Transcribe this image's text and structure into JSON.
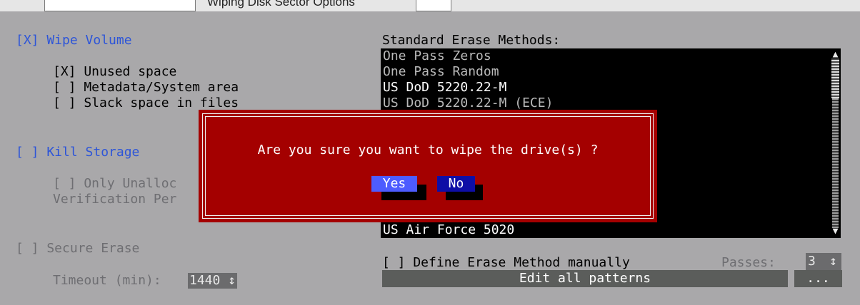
{
  "top_bar": {
    "text": "Wiping Disk Sector Options"
  },
  "wipe_volume": {
    "label": "[X] Wipe Volume",
    "options": [
      "[X] Unused space",
      "[ ] Metadata/System area",
      "[ ] Slack space in files"
    ]
  },
  "kill_storage": {
    "label": "[ ] Kill Storage",
    "options": [
      "[ ] Only Unalloc",
      "Verification Per"
    ]
  },
  "secure_erase": {
    "label": "[ ] Secure Erase",
    "timeout_label": "Timeout (min):",
    "timeout_value": "1440",
    "stepper_glyph": "↕"
  },
  "methods": {
    "heading": "Standard Erase Methods:",
    "items": [
      "One Pass Zeros",
      "One Pass Random",
      "US DoD 5220.22-M",
      "US DoD 5220.22-M (ECE)"
    ],
    "last_item": "US Air Force 5020",
    "scroll_up": "▲",
    "scroll_down": "▼"
  },
  "manual": {
    "label": "[ ] Define Erase Method manually",
    "passes_label": "Passes:",
    "passes_value": "3",
    "stepper_glyph": "↕",
    "edit_label": "Edit all patterns",
    "dots_label": "..."
  },
  "dialog": {
    "message": "Are you sure you want to wipe the drive(s) ?",
    "yes_label": "Yes",
    "no_label": "No"
  },
  "colors": {
    "background": "#a9a8aa",
    "dialog": "#a40000",
    "accent_blue": "#2d55d8",
    "yes_button": "#4d5cff",
    "no_button": "#0e0ea6"
  }
}
